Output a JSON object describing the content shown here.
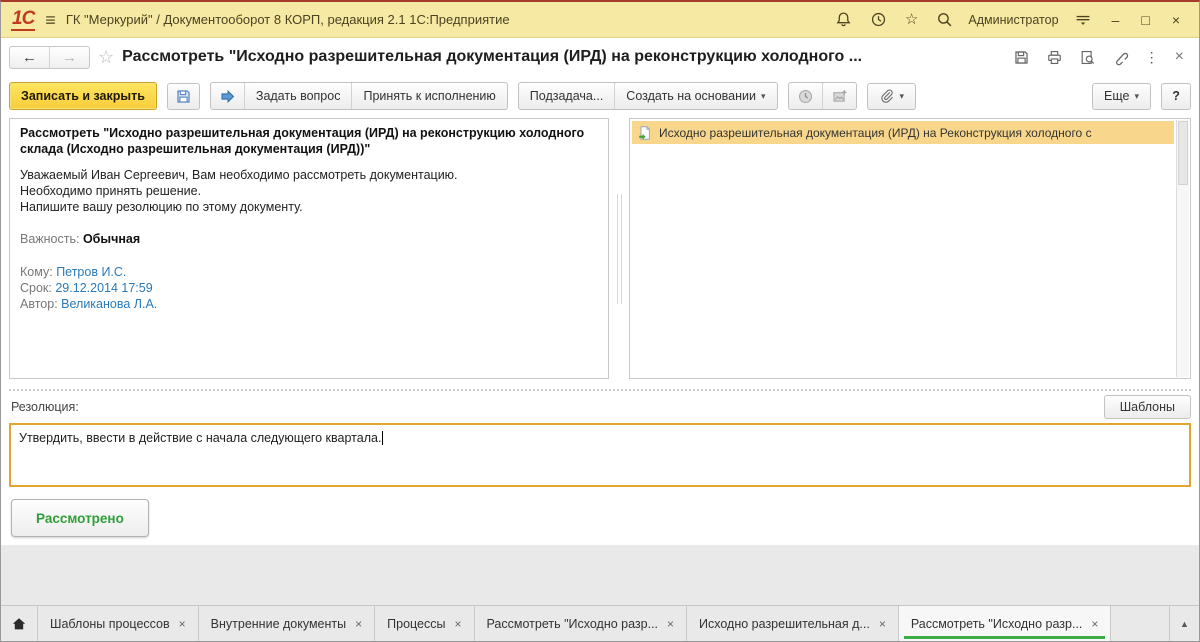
{
  "icons": {
    "logo": "1С",
    "hamburger": "≡",
    "back": "←",
    "forward": "→",
    "favorite_star": "☆",
    "minimize": "–",
    "maximize": "□",
    "close": "×",
    "kebab": "⋮",
    "caret_down": "▾",
    "tab_close": "×",
    "up_arrow": "▲"
  },
  "titlebar": {
    "app_title": "ГК \"Меркурий\" / Документооборот 8 КОРП, редакция 2.1 1С:Предприятие",
    "user": "Администратор"
  },
  "nav": {
    "page_title": "Рассмотреть \"Исходно разрешительная документация (ИРД) на реконструкцию холодного ..."
  },
  "toolbar": {
    "save_and_close": "Записать и закрыть",
    "ask_question": "Задать вопрос",
    "accept_for_execution": "Принять к исполнению",
    "subtask": "Подзадача...",
    "create_based_on": "Создать на основании",
    "more": "Еще",
    "help": "?"
  },
  "task": {
    "title_line": "Рассмотреть \"Исходно разрешительная документация (ИРД) на реконструкцию холодного склада (Исходно разрешительная документация (ИРД))\"",
    "body_line1": "Уважаемый Иван Сергеевич, Вам необходимо рассмотреть документацию.",
    "body_line2": "Необходимо принять решение.",
    "body_line3": "Напишите вашу резолюцию по этому документу.",
    "importance_label": "Важность:",
    "importance_value": "Обычная",
    "to_label": "Кому:",
    "to_value": "Петров И.С.",
    "due_label": "Срок:",
    "due_value": "29.12.2014 17:59",
    "author_label": "Автор:",
    "author_value": "Великанова Л.А."
  },
  "subject_list": {
    "item_label": "Исходно разрешительная документация (ИРД) на Реконструкция холодного с"
  },
  "resolution": {
    "label": "Резолюция:",
    "templates_button": "Шаблоны",
    "text": "Утвердить, ввести в действие с начала следующего квартала."
  },
  "footer": {
    "reviewed_button": "Рассмотрено"
  },
  "tabs": [
    {
      "label": "Шаблоны процессов"
    },
    {
      "label": "Внутренние документы"
    },
    {
      "label": "Процессы"
    },
    {
      "label": "Рассмотреть \"Исходно разр..."
    },
    {
      "label": "Исходно разрешительная д..."
    },
    {
      "label": "Рассмотреть \"Исходно разр..."
    }
  ],
  "colors": {
    "titlebar_bg": "#f6e9a4",
    "primary_button_bg": "#ffd952",
    "focus_border": "#dfa72e",
    "selection_bg": "#f8d78d",
    "link": "#2a7ab8",
    "success_green": "#2f9e38",
    "active_tab_underline": "#3cae46"
  }
}
